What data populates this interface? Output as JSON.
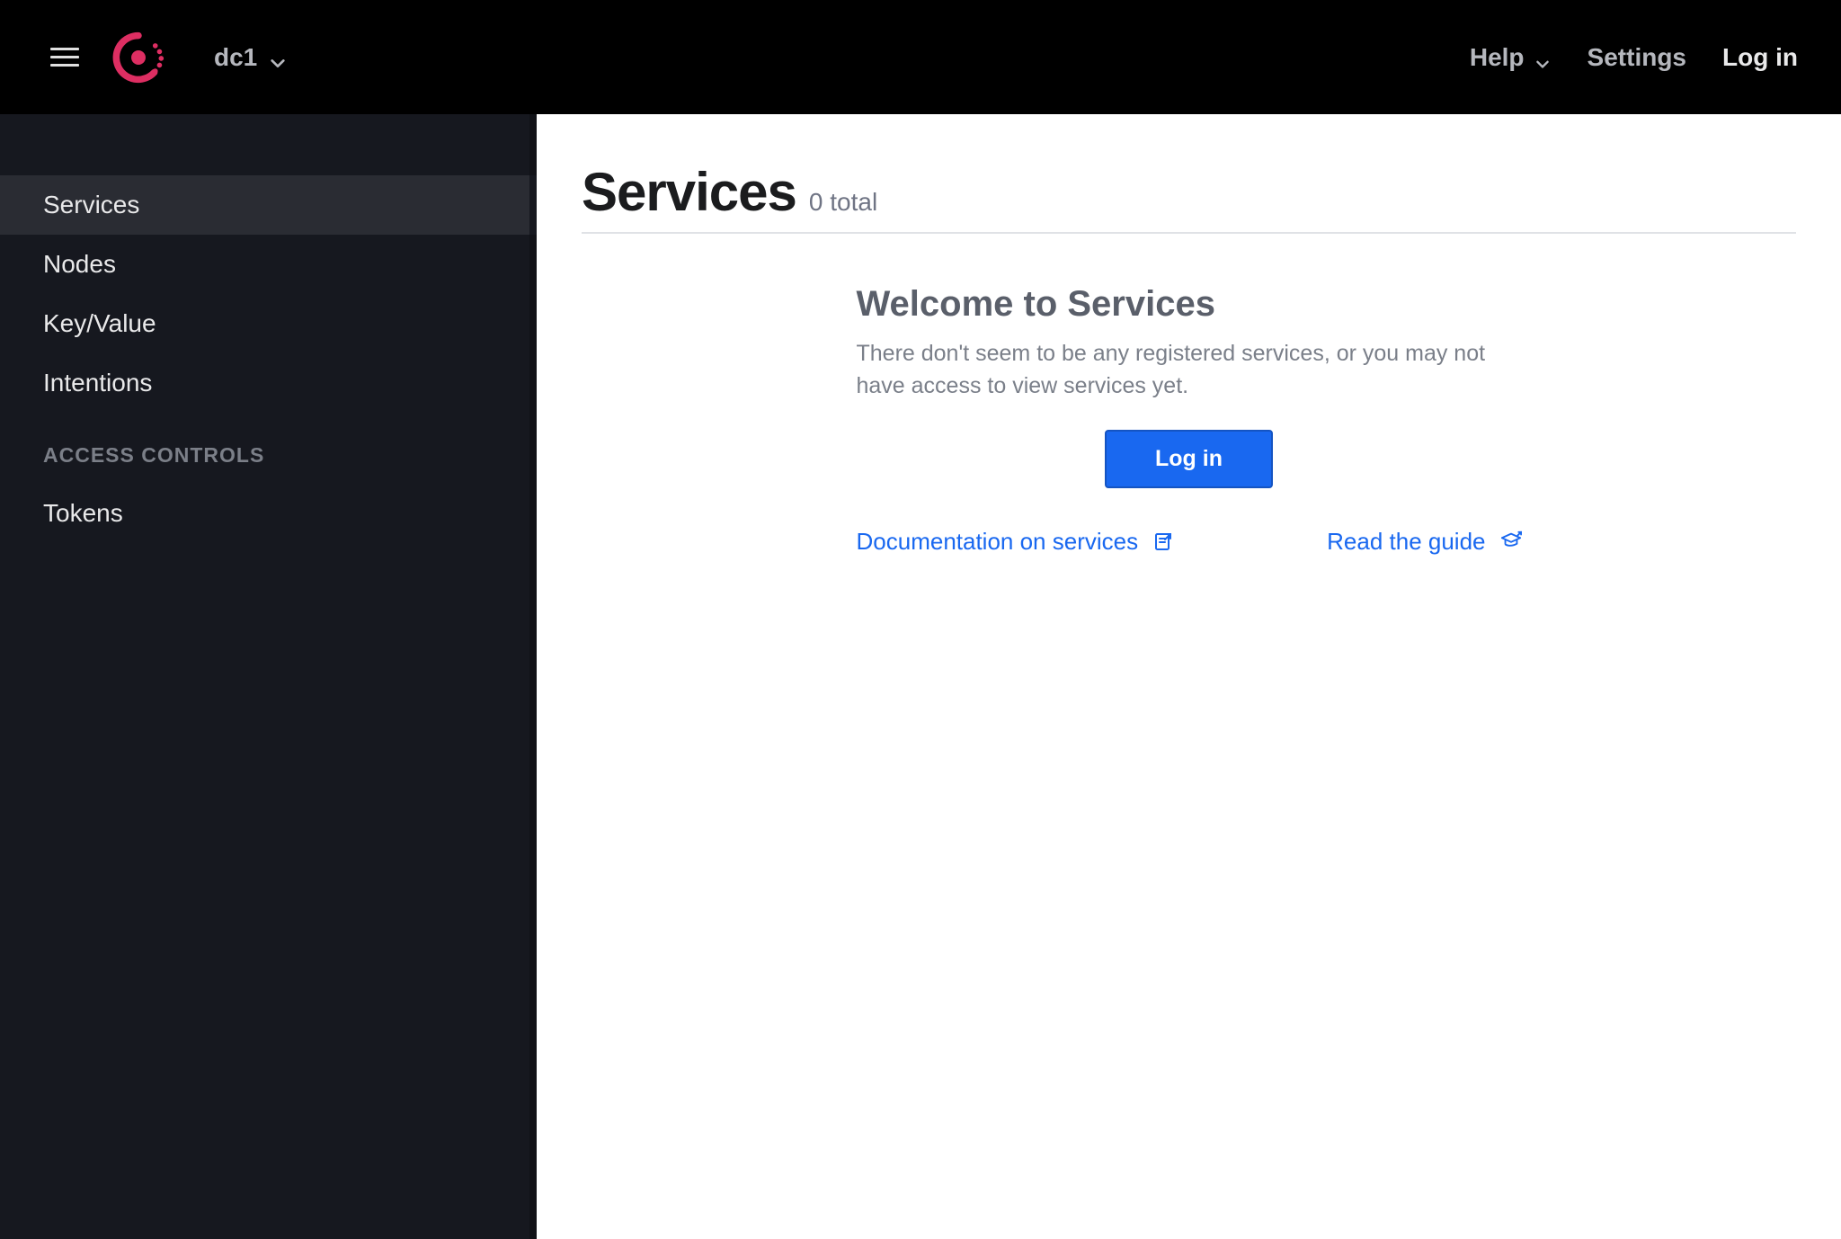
{
  "header": {
    "datacenter": "dc1",
    "help": "Help",
    "settings": "Settings",
    "login": "Log in"
  },
  "sidebar": {
    "items": [
      {
        "label": "Services",
        "active": true
      },
      {
        "label": "Nodes",
        "active": false
      },
      {
        "label": "Key/Value",
        "active": false
      },
      {
        "label": "Intentions",
        "active": false
      }
    ],
    "section_label": "ACCESS CONTROLS",
    "access_items": [
      {
        "label": "Tokens"
      }
    ]
  },
  "page": {
    "title": "Services",
    "count_label": "0 total",
    "count": 0
  },
  "empty_state": {
    "title": "Welcome to Services",
    "description": "There don't seem to be any registered services, or you may not have access to view services yet.",
    "login_button": "Log in",
    "doc_link": "Documentation on services",
    "guide_link": "Read the guide"
  },
  "colors": {
    "accent": "#1968f0",
    "brand": "#dd2e62",
    "topbar": "#000000",
    "sidebar": "#16181f"
  }
}
